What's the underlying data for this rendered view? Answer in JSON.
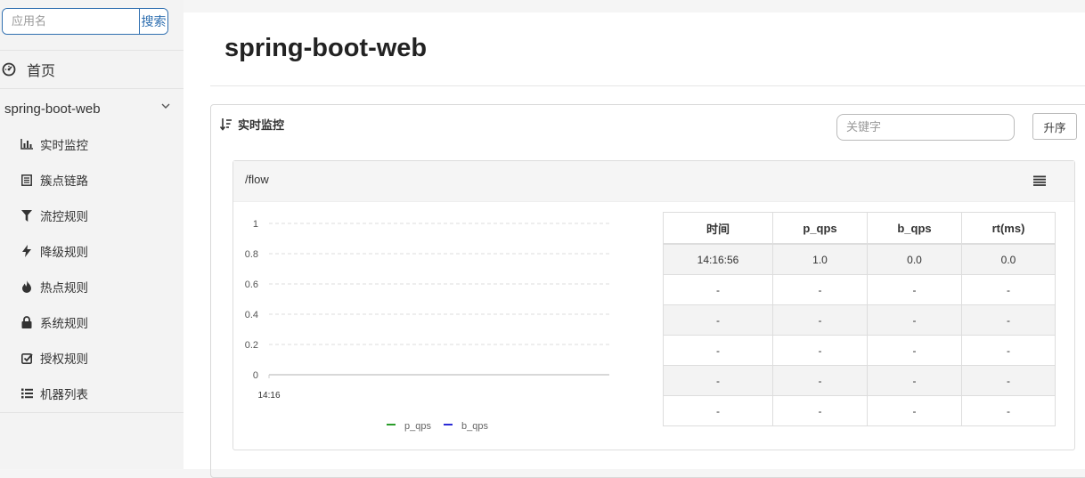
{
  "sidebar": {
    "search": {
      "placeholder": "应用名",
      "button": "搜索"
    },
    "home": {
      "icon": "dashboard-icon",
      "label": "首页"
    },
    "app": {
      "name": "spring-boot-web",
      "icon": "chevron-down-icon"
    },
    "items": [
      {
        "icon": "bar-chart-icon",
        "label": "实时监控"
      },
      {
        "icon": "list-icon",
        "label": "簇点链路"
      },
      {
        "icon": "filter-icon",
        "label": "流控规则"
      },
      {
        "icon": "bolt-icon",
        "label": "降级规则"
      },
      {
        "icon": "fire-icon",
        "label": "热点规则"
      },
      {
        "icon": "lock-icon",
        "label": "系统规则"
      },
      {
        "icon": "check-square-icon",
        "label": "授权规则"
      },
      {
        "icon": "list-ul-icon",
        "label": "机器列表"
      }
    ]
  },
  "main": {
    "title": "spring-boot-web",
    "panel": {
      "title": "实时监控",
      "icon": "sort-icon",
      "keyword_placeholder": "关键字",
      "sort_button": "升序"
    },
    "card": {
      "resource": "/flow",
      "menu_icon": "menu-icon"
    },
    "table": {
      "headers": [
        "时间",
        "p_qps",
        "b_qps",
        "rt(ms)"
      ],
      "rows": [
        [
          "14:16:56",
          "1.0",
          "0.0",
          "0.0"
        ],
        [
          "-",
          "-",
          "-",
          "-"
        ],
        [
          "-",
          "-",
          "-",
          "-"
        ],
        [
          "-",
          "-",
          "-",
          "-"
        ],
        [
          "-",
          "-",
          "-",
          "-"
        ],
        [
          "-",
          "-",
          "-",
          "-"
        ]
      ]
    }
  },
  "chart_data": {
    "type": "line",
    "x": [
      "14:16"
    ],
    "xlabel": "",
    "ylabel": "",
    "yticks": [
      "1",
      "0.8",
      "0.6",
      "0.4",
      "0.2",
      "0"
    ],
    "ylim": [
      0,
      1
    ],
    "grid": true,
    "legend_placement": "bottom",
    "series": [
      {
        "name": "p_qps",
        "color": "#2a9d2a",
        "values": []
      },
      {
        "name": "b_qps",
        "color": "#2b2bd6",
        "values": []
      }
    ]
  }
}
